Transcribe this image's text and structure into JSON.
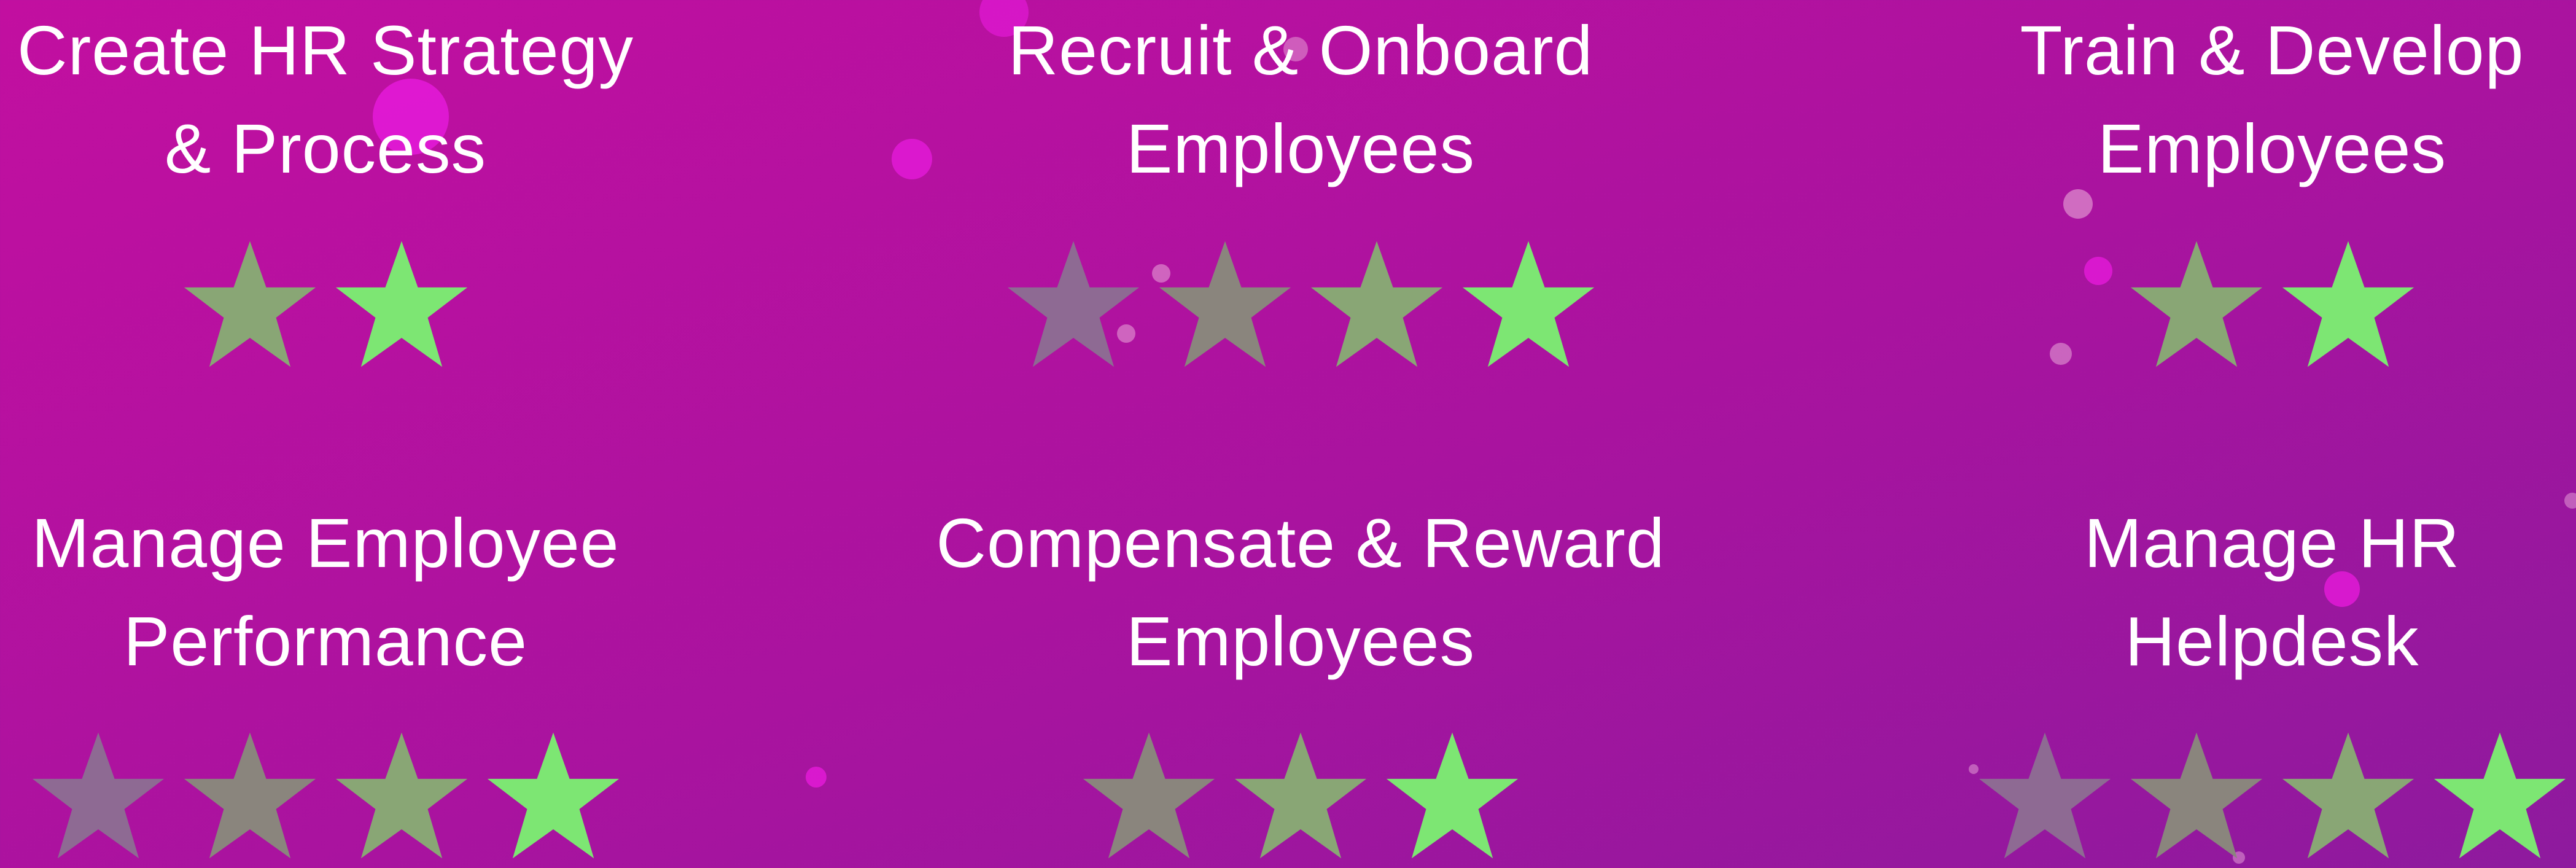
{
  "colors": {
    "star_gradient": [
      "#8e6a93",
      "#8a857d",
      "#89a675",
      "#7de673"
    ],
    "bubble_bright": "#e21ad6",
    "bubble_soft": "#e9a8d9"
  },
  "cards": [
    {
      "title_lines": [
        "Create HR Strategy",
        "& Process"
      ],
      "rating": 2
    },
    {
      "title_lines": [
        "Recruit & Onboard",
        "Employees"
      ],
      "rating": 4
    },
    {
      "title_lines": [
        "Train & Develop",
        "Employees"
      ],
      "rating": 2
    },
    {
      "title_lines": [
        "Manage Employee",
        "Performance"
      ],
      "rating": 4
    },
    {
      "title_lines": [
        "Compensate & Reward",
        "Employees"
      ],
      "rating": 3
    },
    {
      "title_lines": [
        "Manage HR",
        "Helpdesk"
      ],
      "rating": 4
    }
  ]
}
